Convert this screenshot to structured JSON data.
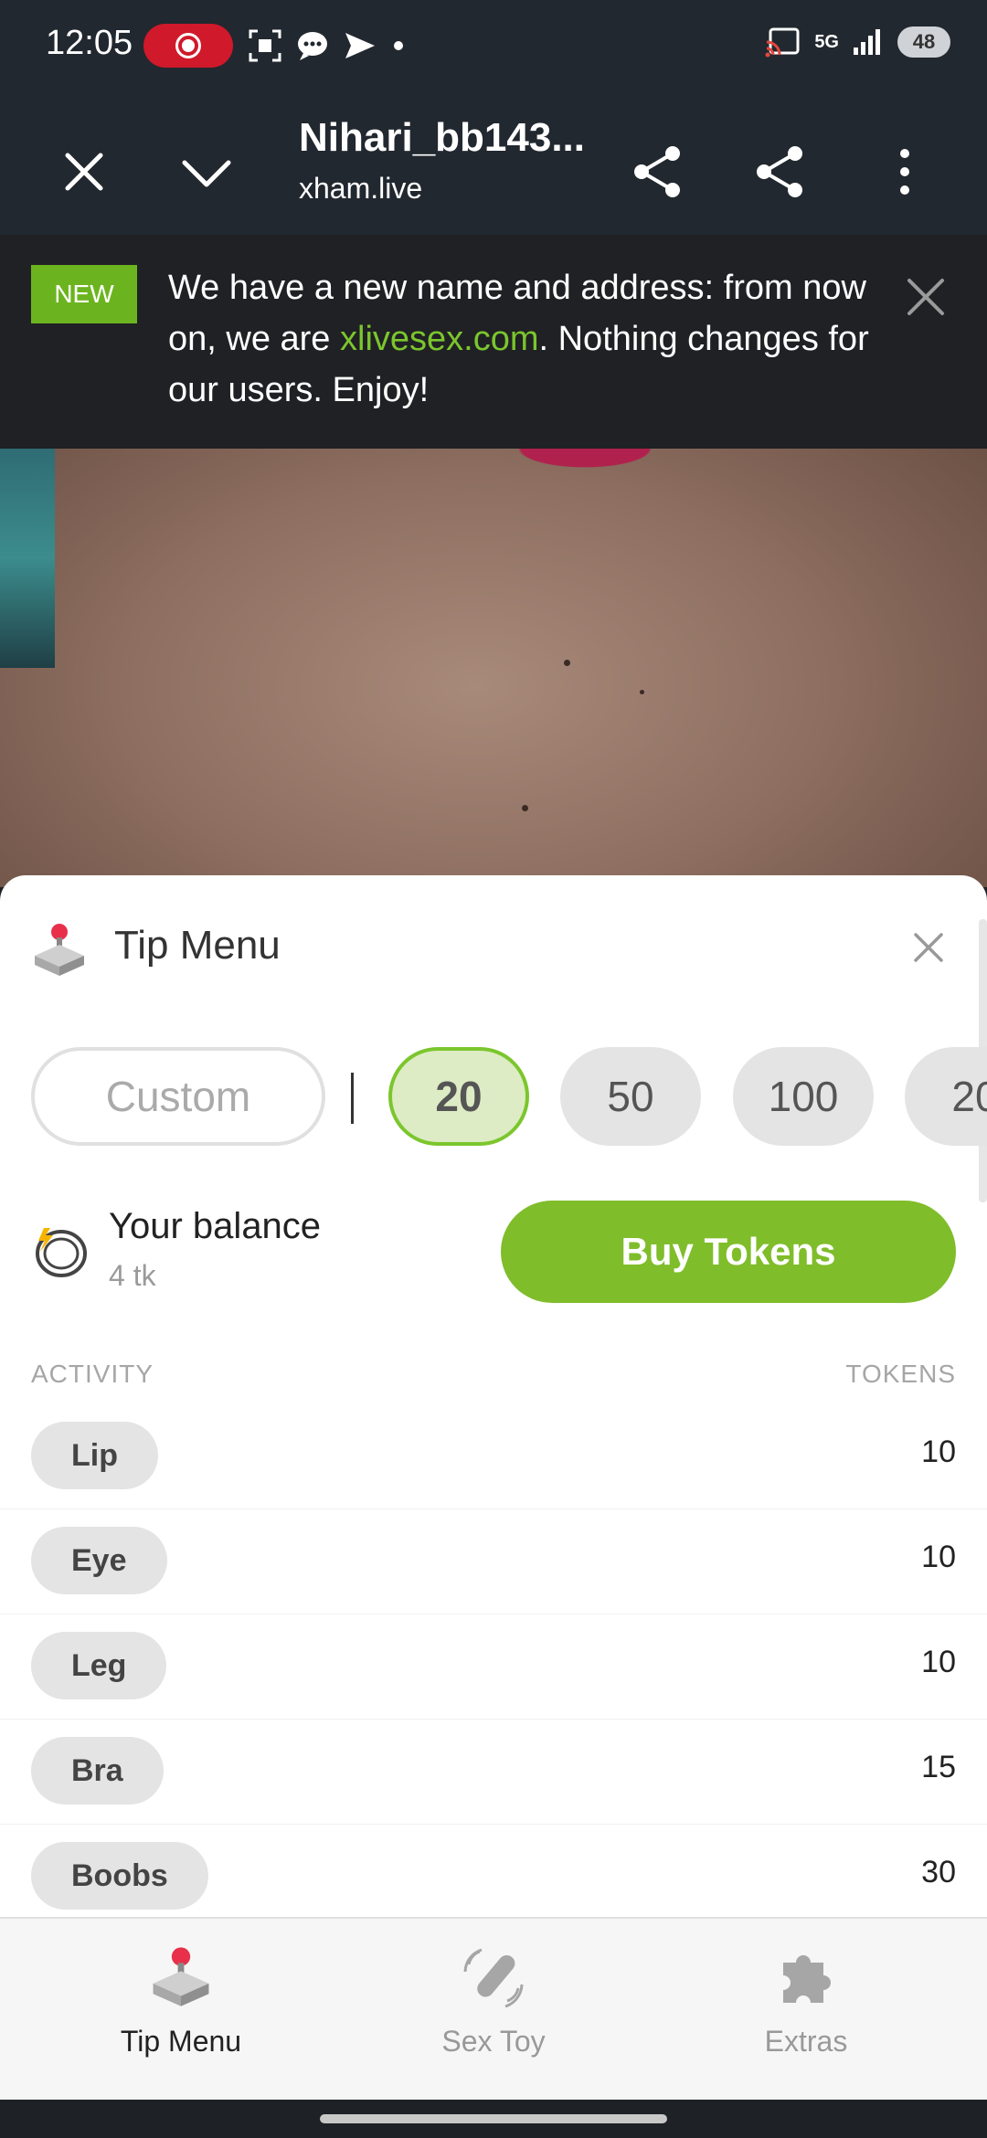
{
  "status_bar": {
    "time": "12:05",
    "battery": "48",
    "network": "5G"
  },
  "toolbar": {
    "title": "Nihari_bb143...",
    "url": "xham.live"
  },
  "banner": {
    "badge": "NEW",
    "text_before": "We have a new name and address: from now on, we are ",
    "link_text": "xlivesex.com",
    "text_after": ". Nothing changes for our users. Enjoy!"
  },
  "tip_menu": {
    "title": "Tip Menu",
    "amounts": {
      "custom_label": "Custom",
      "options": [
        "20",
        "50",
        "100",
        "20"
      ],
      "selected": "20"
    },
    "balance": {
      "label": "Your balance",
      "value": "4 tk",
      "buy_label": "Buy Tokens"
    },
    "columns": {
      "activity": "ACTIVITY",
      "tokens": "TOKENS"
    },
    "activities": [
      {
        "name": "Lip",
        "tokens": "10"
      },
      {
        "name": "Eye",
        "tokens": "10"
      },
      {
        "name": "Leg",
        "tokens": "10"
      },
      {
        "name": "Bra",
        "tokens": "15"
      },
      {
        "name": "Boobs",
        "tokens": "30"
      }
    ]
  },
  "bottom_nav": {
    "items": [
      {
        "label": "Tip Menu",
        "icon": "joystick-icon"
      },
      {
        "label": "Sex Toy",
        "icon": "toy-icon"
      },
      {
        "label": "Extras",
        "icon": "puzzle-icon"
      }
    ]
  },
  "colors": {
    "accent_green": "#7fbd2a",
    "header_bg": "#22282f",
    "live_red": "#d0192a"
  }
}
